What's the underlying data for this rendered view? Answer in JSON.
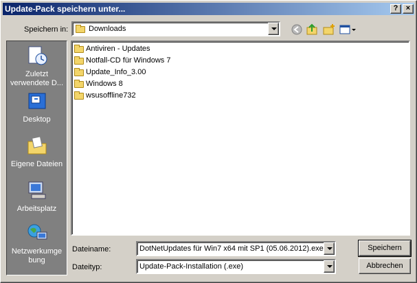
{
  "window": {
    "title": "Update-Pack speichern unter...",
    "help_btn": "?",
    "close_btn": "×"
  },
  "location": {
    "label": "Speichern in:",
    "value": "Downloads"
  },
  "places": [
    {
      "icon": "recent-documents-icon",
      "label": "Zuletzt verwendete D..."
    },
    {
      "icon": "desktop-icon",
      "label": "Desktop"
    },
    {
      "icon": "my-documents-icon",
      "label": "Eigene Dateien"
    },
    {
      "icon": "my-computer-icon",
      "label": "Arbeitsplatz"
    },
    {
      "icon": "network-icon",
      "label": "Netzwerkumge bung"
    }
  ],
  "files": [
    {
      "name": "Antiviren - Updates"
    },
    {
      "name": "Notfall-CD für Windows 7"
    },
    {
      "name": "Update_Info_3.00"
    },
    {
      "name": "Windows 8"
    },
    {
      "name": "wsusoffline732"
    }
  ],
  "filename": {
    "label": "Dateiname:",
    "value": "DotNetUpdates für Win7 x64 mit SP1 (05.06.2012).exe"
  },
  "filetype": {
    "label": "Dateityp:",
    "value": "Update-Pack-Installation (.exe)"
  },
  "buttons": {
    "save": "Speichern",
    "cancel": "Abbrechen"
  }
}
